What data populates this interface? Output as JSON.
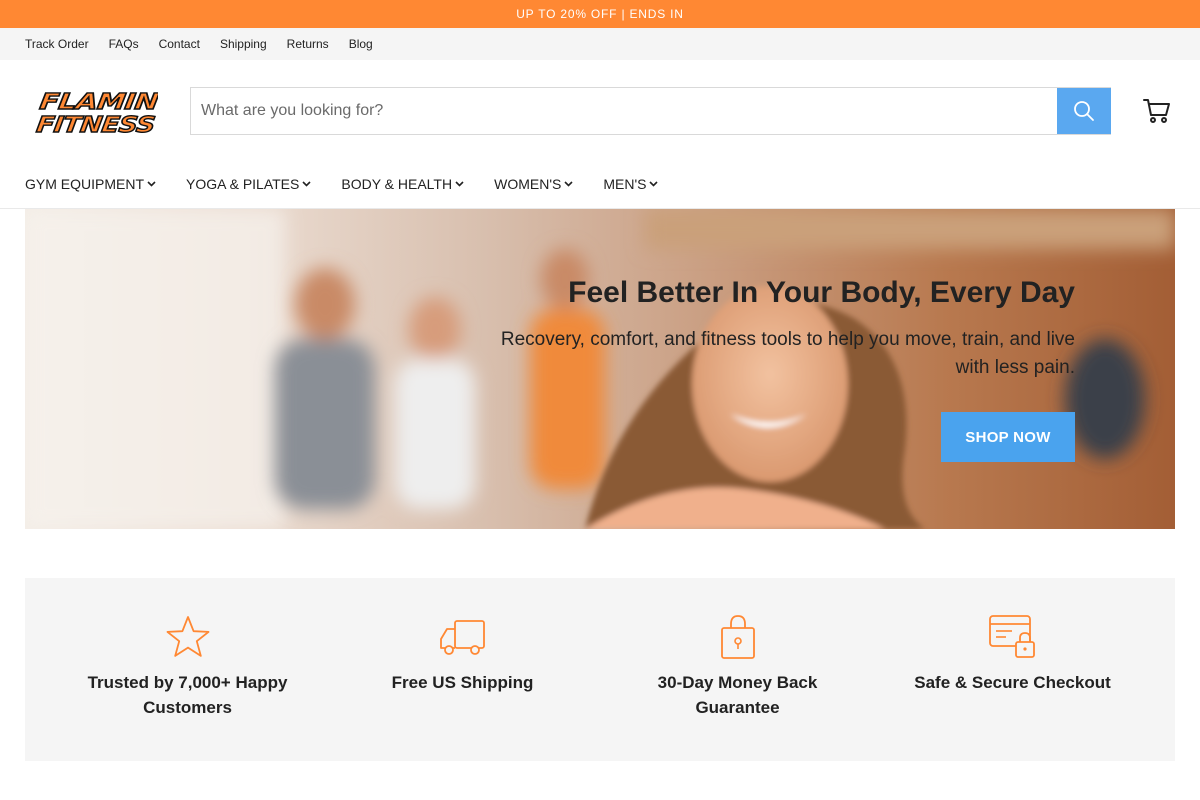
{
  "promo": {
    "text": "UP TO 20% OFF | ENDS IN"
  },
  "utility_nav": {
    "items": [
      "Track Order",
      "FAQs",
      "Contact",
      "Shipping",
      "Returns",
      "Blog"
    ]
  },
  "header": {
    "logo": {
      "line1": "FLAMIN",
      "line2": "FITNESS"
    },
    "search": {
      "placeholder": "What are you looking for?",
      "value": ""
    },
    "icons": {
      "search": "search-icon",
      "cart": "cart-icon"
    }
  },
  "main_nav": {
    "items": [
      "GYM EQUIPMENT",
      "YOGA & PILATES",
      "BODY & HEALTH",
      "WOMEN'S",
      "MEN'S"
    ]
  },
  "hero": {
    "title": "Feel Better In Your Body, Every Day",
    "subtitle": "Recovery, comfort, and fitness tools to help you move, train, and live with less pain.",
    "cta": "SHOP NOW"
  },
  "features": [
    {
      "icon": "star-icon",
      "label": "Trusted by 7,000+ Happy Customers"
    },
    {
      "icon": "truck-icon",
      "label": "Free US Shipping"
    },
    {
      "icon": "lock-bag-icon",
      "label": "30-Day Money Back Guarantee"
    },
    {
      "icon": "secure-card-icon",
      "label": "Safe & Secure Checkout"
    }
  ],
  "colors": {
    "accent": "#ff8833",
    "cta_blue": "#4aa3ee",
    "search_blue": "#5aa8f0",
    "text": "#222222",
    "panel": "#f5f5f5"
  }
}
